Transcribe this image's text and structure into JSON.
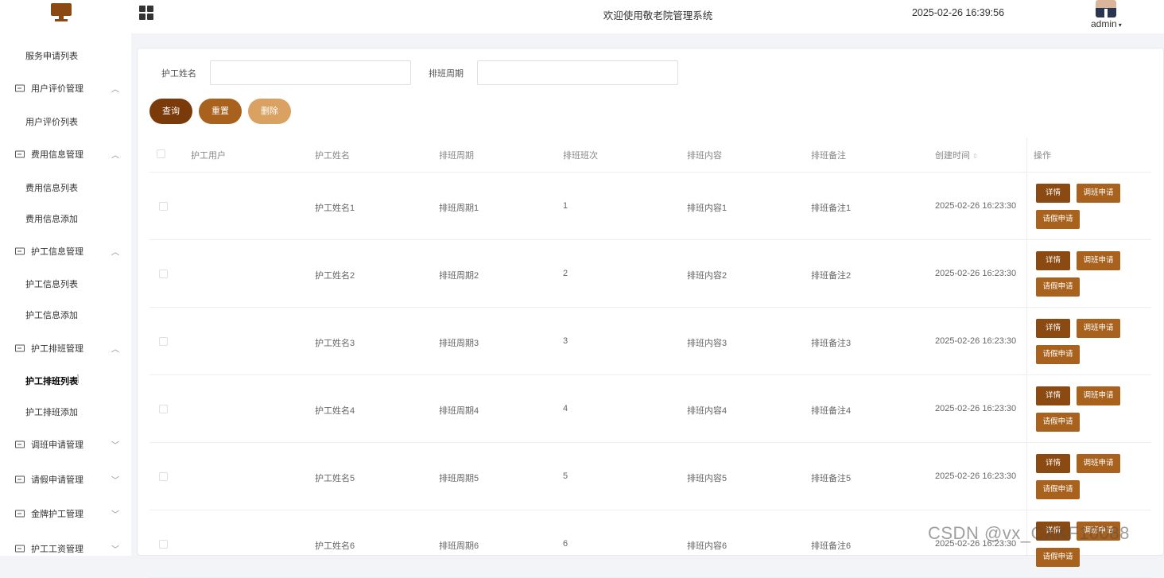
{
  "header": {
    "title": "欢迎使用敬老院管理系统",
    "datetime": "2025-02-26 16:39:56",
    "user": "admin",
    "logo_icon": "monitor-icon",
    "menu_icon": "grid-icon"
  },
  "sidebar": {
    "items": [
      {
        "label": "服务申请列表",
        "type": "sub"
      },
      {
        "label": "用户评价管理",
        "type": "group",
        "chevron": "up"
      },
      {
        "label": "用户评价列表",
        "type": "sub"
      },
      {
        "label": "费用信息管理",
        "type": "group",
        "chevron": "up"
      },
      {
        "label": "费用信息列表",
        "type": "sub"
      },
      {
        "label": "费用信息添加",
        "type": "sub"
      },
      {
        "label": "护工信息管理",
        "type": "group",
        "chevron": "up"
      },
      {
        "label": "护工信息列表",
        "type": "sub"
      },
      {
        "label": "护工信息添加",
        "type": "sub"
      },
      {
        "label": "护工排班管理",
        "type": "group",
        "chevron": "up"
      },
      {
        "label": "护工排班列表",
        "type": "sub",
        "active": true
      },
      {
        "label": "护工排班添加",
        "type": "sub"
      },
      {
        "label": "调班申请管理",
        "type": "group",
        "chevron": "down"
      },
      {
        "label": "请假申请管理",
        "type": "group",
        "chevron": "down"
      },
      {
        "label": "金牌护工管理",
        "type": "group",
        "chevron": "down"
      },
      {
        "label": "护工工资管理",
        "type": "group",
        "chevron": "down"
      }
    ]
  },
  "search": {
    "field1_label": "护工姓名",
    "field1_value": "",
    "field2_label": "排班周期",
    "field2_value": "",
    "query_label": "查询",
    "reset_label": "重置",
    "delete_label": "删除"
  },
  "table": {
    "columns": [
      "护工用户",
      "护工姓名",
      "排班周期",
      "排班班次",
      "排班内容",
      "排班备注",
      "创建时间",
      "操作"
    ],
    "rows": [
      {
        "user": "",
        "name": "护工姓名1",
        "period": "排班周期1",
        "shift": "1",
        "content": "排班内容1",
        "remark": "排班备注1",
        "created": "2025-02-26 16:23:30"
      },
      {
        "user": "",
        "name": "护工姓名2",
        "period": "排班周期2",
        "shift": "2",
        "content": "排班内容2",
        "remark": "排班备注2",
        "created": "2025-02-26 16:23:30"
      },
      {
        "user": "",
        "name": "护工姓名3",
        "period": "排班周期3",
        "shift": "3",
        "content": "排班内容3",
        "remark": "排班备注3",
        "created": "2025-02-26 16:23:30"
      },
      {
        "user": "",
        "name": "护工姓名4",
        "period": "排班周期4",
        "shift": "4",
        "content": "排班内容4",
        "remark": "排班备注4",
        "created": "2025-02-26 16:23:30"
      },
      {
        "user": "",
        "name": "护工姓名5",
        "period": "排班周期5",
        "shift": "5",
        "content": "排班内容5",
        "remark": "排班备注5",
        "created": "2025-02-26 16:23:30"
      },
      {
        "user": "",
        "name": "护工姓名6",
        "period": "排班周期6",
        "shift": "6",
        "content": "排班内容6",
        "remark": "排班备注6",
        "created": "2025-02-26 16:23:30"
      }
    ],
    "actions": {
      "detail": "详情",
      "shift_request": "调班申请",
      "leave_request": "请假申请"
    }
  },
  "watermark": "CSDN @vx_CXKF10088",
  "colors": {
    "query": "#7a3a0a",
    "reset": "#a8621d",
    "delete": "#d9a262",
    "detail": "#8b4a12",
    "action": "#a8621d",
    "logo": "#8b4a12"
  }
}
